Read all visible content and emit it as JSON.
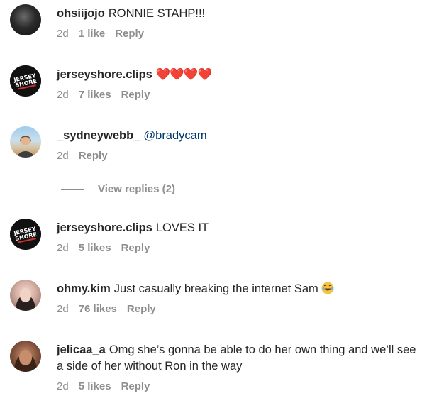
{
  "comments": [
    {
      "username": "ohsiijojo",
      "text": "RONNIE STAHP!!!",
      "time": "2d",
      "likes": "1 like",
      "reply": "Reply",
      "avatar": "portrait-photo"
    },
    {
      "username": "jerseyshore.clips",
      "text": "",
      "emoji": "❤️❤️❤️❤️",
      "time": "2d",
      "likes": "7 likes",
      "reply": "Reply",
      "avatar": "jersey-shore-logo"
    },
    {
      "username": "_sydneywebb_",
      "mention": "@bradycam",
      "time": "2d",
      "reply": "Reply",
      "avatar": "beach-photo"
    },
    {
      "username": "jerseyshore.clips",
      "text": "LOVES IT",
      "time": "2d",
      "likes": "5 likes",
      "reply": "Reply",
      "avatar": "jersey-shore-logo"
    },
    {
      "username": "ohmy.kim",
      "text": "Just casually breaking the internet Sam",
      "emoji": "face-with-tears-of-joy",
      "time": "2d",
      "likes": "76 likes",
      "reply": "Reply",
      "avatar": "portrait-photo"
    },
    {
      "username": "jelicaa_a",
      "text": "Omg she’s gonna be able to do her own thing and we’ll see a side of her without Ron in the way",
      "time": "2d",
      "likes": "5 likes",
      "reply": "Reply",
      "avatar": "portrait-photo"
    }
  ],
  "view_replies": "View replies (2)",
  "logo_text": {
    "line1": "JERSEY",
    "line2": "SHORE"
  },
  "colors": {
    "text": "#262626",
    "meta": "#8e8e8e",
    "mention": "#00376b",
    "heart": "#ed4956"
  }
}
